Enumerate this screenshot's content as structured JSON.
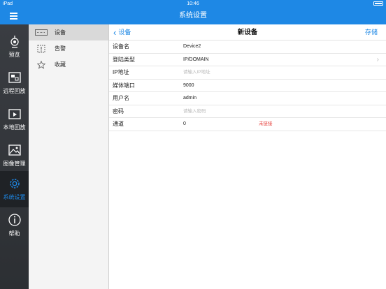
{
  "status_bar": {
    "device": "iPad",
    "time": "10:46"
  },
  "app": {
    "title": "系统设置"
  },
  "sidebar": {
    "items": [
      {
        "label": "预览",
        "icon": "camera-icon",
        "active": false
      },
      {
        "label": "远程回放",
        "icon": "remote-playback-icon",
        "active": false
      },
      {
        "label": "本地回放",
        "icon": "local-playback-icon",
        "active": false
      },
      {
        "label": "图像管理",
        "icon": "image-icon",
        "active": false
      },
      {
        "label": "系统设置",
        "icon": "settings-gear-icon",
        "active": true
      },
      {
        "label": "帮助",
        "icon": "info-icon",
        "active": false
      }
    ]
  },
  "submenu": {
    "items": [
      {
        "label": "设备",
        "icon": "device-icon",
        "active": true
      },
      {
        "label": "告警",
        "icon": "alarm-icon",
        "active": false
      },
      {
        "label": "收藏",
        "icon": "star-icon",
        "active": false
      }
    ]
  },
  "content": {
    "back_label": "设备",
    "title": "新设备",
    "save_label": "存储",
    "fields": [
      {
        "label": "设备名",
        "value": "Device2",
        "placeholder": ""
      },
      {
        "label": "登陆类型",
        "value": "IP/DOMAIN",
        "placeholder": ""
      },
      {
        "label": "IP地址",
        "value": "",
        "placeholder": "请输入IP地址"
      },
      {
        "label": "媒体端口",
        "value": "9000",
        "placeholder": ""
      },
      {
        "label": "用户名",
        "value": "admin",
        "placeholder": ""
      },
      {
        "label": "密码",
        "value": "",
        "placeholder": "请输入密码"
      },
      {
        "label": "通道",
        "value": "0",
        "placeholder": ""
      }
    ],
    "channel_status": "未链接",
    "colors": {
      "accent": "#1e88e5",
      "warning": "#e53935"
    }
  }
}
